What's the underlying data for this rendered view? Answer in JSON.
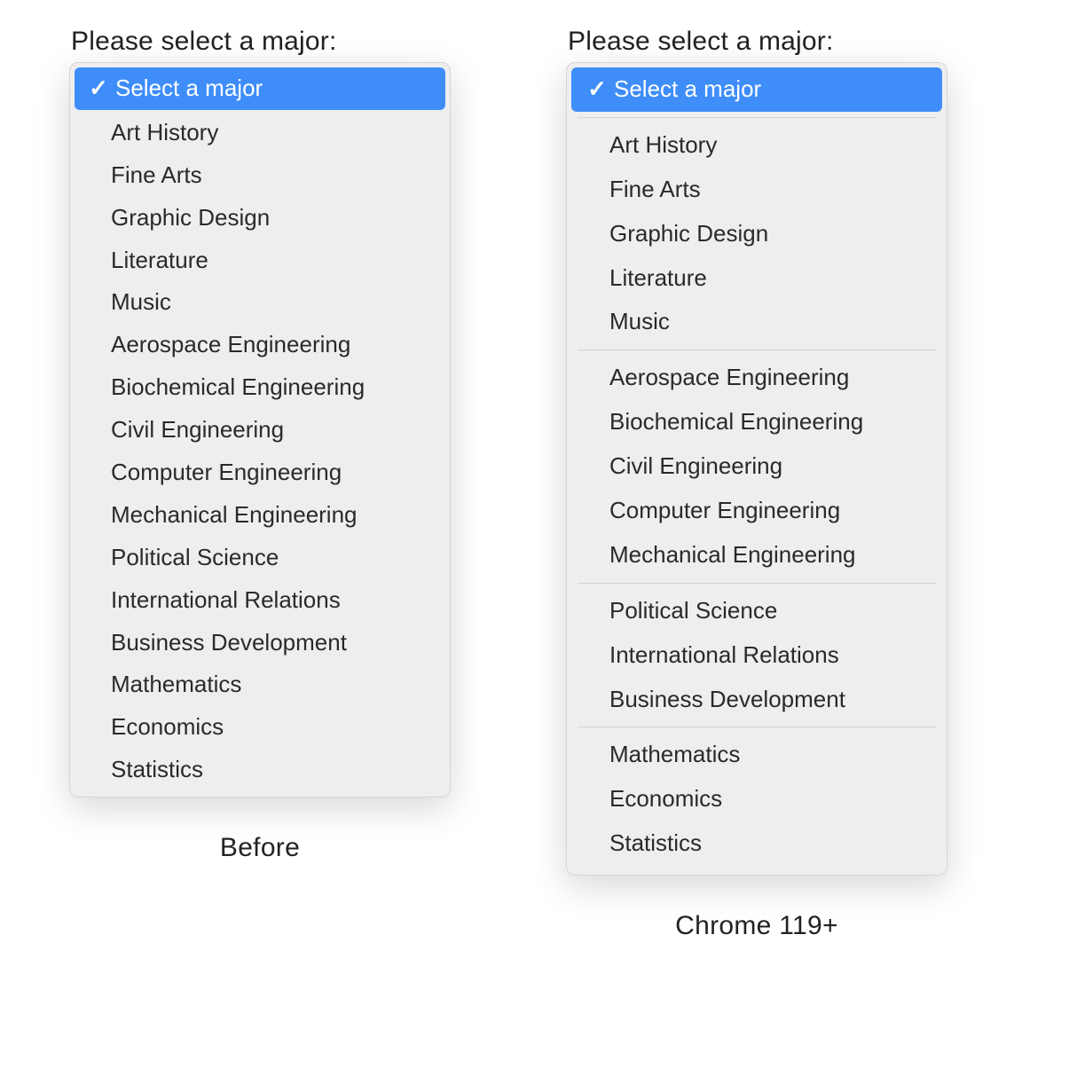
{
  "label": "Please select a major:",
  "placeholder": "Select a major",
  "before": {
    "caption": "Before",
    "options": [
      "Art History",
      "Fine Arts",
      "Graphic Design",
      "Literature",
      "Music",
      "Aerospace Engineering",
      "Biochemical Engineering",
      "Civil Engineering",
      "Computer Engineering",
      "Mechanical Engineering",
      "Political Science",
      "International Relations",
      "Business Development",
      "Mathematics",
      "Economics",
      "Statistics"
    ]
  },
  "after": {
    "caption": "Chrome 119+",
    "groups": [
      [
        "Art History",
        "Fine Arts",
        "Graphic Design",
        "Literature",
        "Music"
      ],
      [
        "Aerospace Engineering",
        "Biochemical Engineering",
        "Civil Engineering",
        "Computer Engineering",
        "Mechanical Engineering"
      ],
      [
        "Political Science",
        "International Relations",
        "Business Development"
      ],
      [
        "Mathematics",
        "Economics",
        "Statistics"
      ]
    ]
  }
}
